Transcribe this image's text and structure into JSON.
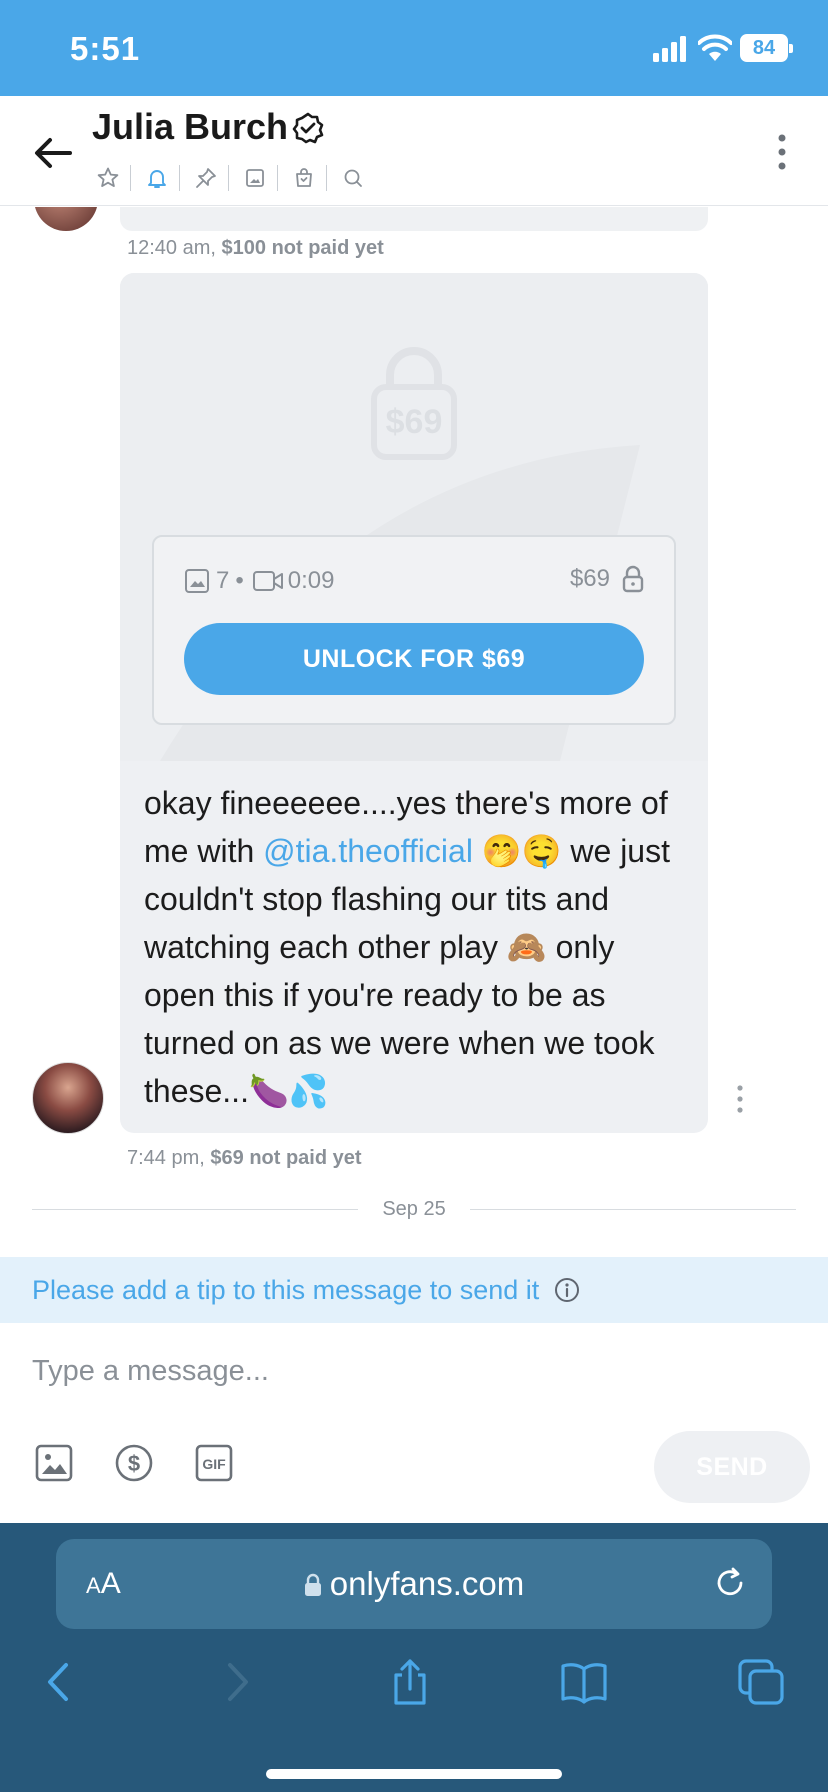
{
  "status_bar": {
    "time": "5:51",
    "battery": "84"
  },
  "header": {
    "title": "Julia Burch",
    "icons": [
      "star-icon",
      "bell-icon",
      "pin-icon",
      "image-icon",
      "bag-icon",
      "search-icon"
    ]
  },
  "messages": {
    "prev_meta": {
      "time": "12:40 am,",
      "status": "$100 not paid yet"
    },
    "locked": {
      "watermark_price": "$69",
      "photo_count": "7",
      "video_duration": "0:09",
      "price": "$69",
      "unlock_label": "UNLOCK FOR $69"
    },
    "text_before": "okay fineeeeee....yes there's more of me with ",
    "mention": "@tia.theofficial",
    "text_after": " 🤭🤤 we just couldn't stop flashing our tits and watching each other play 🙈 only open this if you're ready to be as turned on as we were when we took these...🍆💦",
    "meta": {
      "time": "7:44 pm,",
      "status": "$69 not paid yet"
    },
    "date_separator": "Sep 25"
  },
  "tip_notice": "Please add a tip to this message to send it",
  "composer": {
    "placeholder": "Type a message...",
    "send_label": "SEND"
  },
  "browser": {
    "aa_label_small": "A",
    "aa_label_large": "A",
    "url": "onlyfans.com"
  },
  "colors": {
    "accent": "#4aa7e8",
    "safari_bg": "#27587a",
    "bubble_bg": "#eef0f3",
    "muted": "#8a9097"
  }
}
